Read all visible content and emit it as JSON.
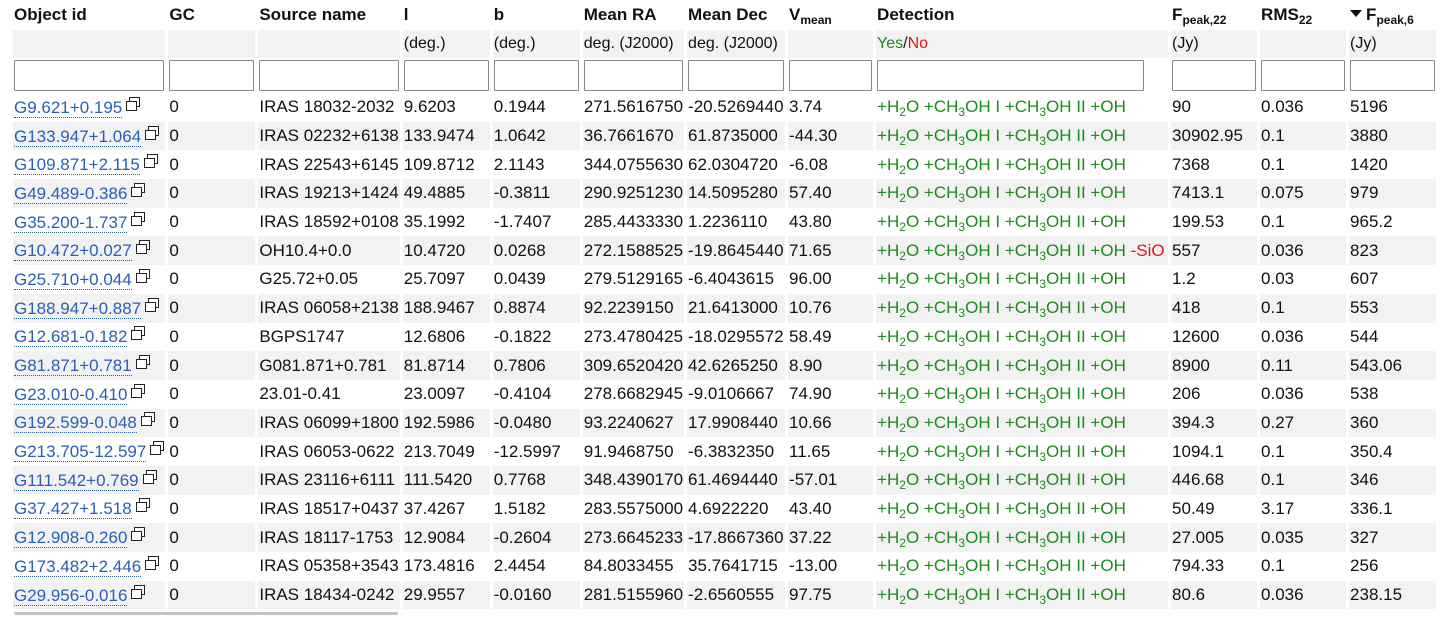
{
  "headers": {
    "object_id": "Object id",
    "gc": "GC",
    "source_name": "Source name",
    "l": "l",
    "b": "b",
    "mean_ra": "Mean RA",
    "mean_dec": "Mean Dec",
    "vmean_main": "V",
    "vmean_sub": "mean",
    "detection": "Detection",
    "fpeak22_main": "F",
    "fpeak22_sub": "peak,22",
    "rms22_main": "RMS",
    "rms22_sub": "22",
    "fpeak6_main": "F",
    "fpeak6_sub": "peak,6"
  },
  "units": {
    "l": "(deg.)",
    "b": "(deg.)",
    "mean_ra": "deg. (J2000)",
    "mean_dec": "deg. (J2000)",
    "detection_yes": "Yes",
    "detection_sep": "/",
    "detection_no": "No",
    "fpeak22": "(Jy)",
    "fpeak6": "(Jy)"
  },
  "filters": {
    "object_id": "",
    "gc": "",
    "source_name": "",
    "l": "",
    "b": "",
    "mean_ra": "",
    "mean_dec": "",
    "vmean": "",
    "detection": "",
    "fpeak22": "",
    "rms22": "",
    "fpeak6": ""
  },
  "sort": {
    "column": "fpeak6",
    "direction": "descending"
  },
  "colors": {
    "link": "#2860b8",
    "detected": "#1a8c1a",
    "not_detected": "#e01515",
    "stripe": "#f2f2f2"
  },
  "icons": {
    "external_link": "popup-window-icon",
    "sort": "sort-desc-arrow-icon"
  },
  "detection_parts": {
    "plus": "+",
    "minus": "-",
    "h": "H",
    "two": "2",
    "o": "O",
    "ch": "CH",
    "three": "3",
    "oh": "OH",
    "roman1": "I",
    "roman2": "II",
    "plus_oh": "+OH",
    "minus_sio": "-SiO"
  },
  "rows": [
    {
      "id": "G9.621+0.195",
      "gc": "0",
      "source": "IRAS 18032-2032",
      "l": "9.6203",
      "b": "0.1944",
      "ra": "271.5616750",
      "dec": "-20.5269440",
      "v": "3.74",
      "sio": false,
      "f22": "90",
      "rms22": "0.036",
      "f6": "5196"
    },
    {
      "id": "G133.947+1.064",
      "gc": "0",
      "source": "IRAS 02232+6138",
      "l": "133.9474",
      "b": "1.0642",
      "ra": "36.7661670",
      "dec": "61.8735000",
      "v": "-44.30",
      "sio": false,
      "f22": "30902.95",
      "rms22": "0.1",
      "f6": "3880"
    },
    {
      "id": "G109.871+2.115",
      "gc": "0",
      "source": "IRAS 22543+6145",
      "l": "109.8712",
      "b": "2.1143",
      "ra": "344.0755630",
      "dec": "62.0304720",
      "v": "-6.08",
      "sio": false,
      "f22": "7368",
      "rms22": "0.1",
      "f6": "1420"
    },
    {
      "id": "G49.489-0.386",
      "gc": "0",
      "source": "IRAS 19213+1424",
      "l": "49.4885",
      "b": "-0.3811",
      "ra": "290.9251230",
      "dec": "14.5095280",
      "v": "57.40",
      "sio": false,
      "f22": "7413.1",
      "rms22": "0.075",
      "f6": "979"
    },
    {
      "id": "G35.200-1.737",
      "gc": "0",
      "source": "IRAS 18592+0108",
      "l": "35.1992",
      "b": "-1.7407",
      "ra": "285.4433330",
      "dec": "1.2236110",
      "v": "43.80",
      "sio": false,
      "f22": "199.53",
      "rms22": "0.1",
      "f6": "965.2"
    },
    {
      "id": "G10.472+0.027",
      "gc": "0",
      "source": "OH10.4+0.0",
      "l": "10.4720",
      "b": "0.0268",
      "ra": "272.1588525",
      "dec": "-19.8645440",
      "v": "71.65",
      "sio": true,
      "f22": "557",
      "rms22": "0.036",
      "f6": "823"
    },
    {
      "id": "G25.710+0.044",
      "gc": "0",
      "source": "G25.72+0.05",
      "l": "25.7097",
      "b": "0.0439",
      "ra": "279.5129165",
      "dec": "-6.4043615",
      "v": "96.00",
      "sio": false,
      "f22": "1.2",
      "rms22": "0.03",
      "f6": "607"
    },
    {
      "id": "G188.947+0.887",
      "gc": "0",
      "source": "IRAS 06058+2138",
      "l": "188.9467",
      "b": "0.8874",
      "ra": "92.2239150",
      "dec": "21.6413000",
      "v": "10.76",
      "sio": false,
      "f22": "418",
      "rms22": "0.1",
      "f6": "553"
    },
    {
      "id": "G12.681-0.182",
      "gc": "0",
      "source": "BGPS1747",
      "l": "12.6806",
      "b": "-0.1822",
      "ra": "273.4780425",
      "dec": "-18.0295572",
      "v": "58.49",
      "sio": false,
      "f22": "12600",
      "rms22": "0.036",
      "f6": "544"
    },
    {
      "id": "G81.871+0.781",
      "gc": "0",
      "source": "G081.871+0.781",
      "l": "81.8714",
      "b": "0.7806",
      "ra": "309.6520420",
      "dec": "42.6265250",
      "v": "8.90",
      "sio": false,
      "f22": "8900",
      "rms22": "0.11",
      "f6": "543.06"
    },
    {
      "id": "G23.010-0.410",
      "gc": "0",
      "source": "23.01-0.41",
      "l": "23.0097",
      "b": "-0.4104",
      "ra": "278.6682945",
      "dec": "-9.0106667",
      "v": "74.90",
      "sio": false,
      "f22": "206",
      "rms22": "0.036",
      "f6": "538"
    },
    {
      "id": "G192.599-0.048",
      "gc": "0",
      "source": "IRAS 06099+1800",
      "l": "192.5986",
      "b": "-0.0480",
      "ra": "93.2240627",
      "dec": "17.9908440",
      "v": "10.66",
      "sio": false,
      "f22": "394.3",
      "rms22": "0.27",
      "f6": "360"
    },
    {
      "id": "G213.705-12.597",
      "gc": "0",
      "source": "IRAS 06053-0622",
      "l": "213.7049",
      "b": "-12.5997",
      "ra": "91.9468750",
      "dec": "-6.3832350",
      "v": "11.65",
      "sio": false,
      "f22": "1094.1",
      "rms22": "0.1",
      "f6": "350.4"
    },
    {
      "id": "G111.542+0.769",
      "gc": "0",
      "source": "IRAS 23116+6111",
      "l": "111.5420",
      "b": "0.7768",
      "ra": "348.4390170",
      "dec": "61.4694440",
      "v": "-57.01",
      "sio": false,
      "f22": "446.68",
      "rms22": "0.1",
      "f6": "346"
    },
    {
      "id": "G37.427+1.518",
      "gc": "0",
      "source": "IRAS 18517+0437",
      "l": "37.4267",
      "b": "1.5182",
      "ra": "283.5575000",
      "dec": "4.6922220",
      "v": "43.40",
      "sio": false,
      "f22": "50.49",
      "rms22": "3.17",
      "f6": "336.1"
    },
    {
      "id": "G12.908-0.260",
      "gc": "0",
      "source": "IRAS 18117-1753",
      "l": "12.9084",
      "b": "-0.2604",
      "ra": "273.6645233",
      "dec": "-17.8667360",
      "v": "37.22",
      "sio": false,
      "f22": "27.005",
      "rms22": "0.035",
      "f6": "327"
    },
    {
      "id": "G173.482+2.446",
      "gc": "0",
      "source": "IRAS 05358+3543",
      "l": "173.4816",
      "b": "2.4454",
      "ra": "84.8033455",
      "dec": "35.7641715",
      "v": "-13.00",
      "sio": false,
      "f22": "794.33",
      "rms22": "0.1",
      "f6": "256"
    },
    {
      "id": "G29.956-0.016",
      "gc": "0",
      "source": "IRAS 18434-0242",
      "l": "29.9557",
      "b": "-0.0160",
      "ra": "281.5155960",
      "dec": "-2.6560555",
      "v": "97.75",
      "sio": false,
      "f22": "80.6",
      "rms22": "0.036",
      "f6": "238.15"
    }
  ]
}
